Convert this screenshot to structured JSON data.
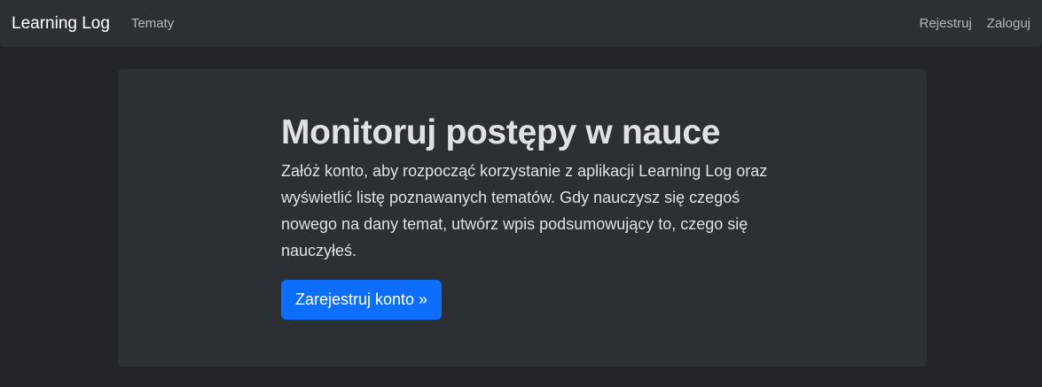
{
  "nav": {
    "brand": "Learning Log",
    "topics": "Tematy",
    "register": "Rejestruj",
    "login": "Zaloguj"
  },
  "hero": {
    "title": "Monitoruj postępy w nauce",
    "text": "Załóż konto, aby rozpocząć korzystanie z aplikacji Learning Log oraz wyświetlić listę poznawanych tematów. Gdy nauczysz się czegoś nowego na dany temat, utwórz wpis podsumowujący to, czego się nauczyłeś.",
    "button": "Zarejestruj konto »"
  }
}
